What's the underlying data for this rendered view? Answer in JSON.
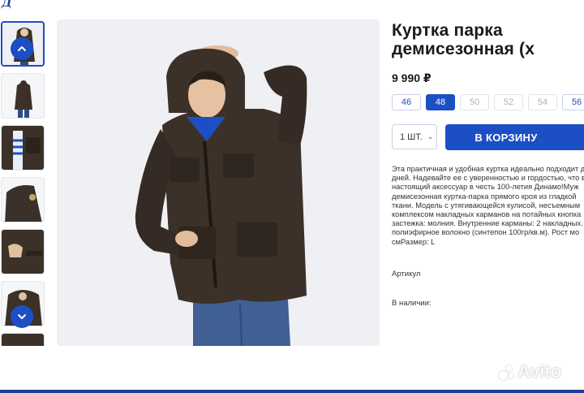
{
  "brand": {
    "logo_text": "Д"
  },
  "gallery": {
    "thumbnail_count": 7,
    "active_index": 0,
    "prev_icon": "chevron-up-icon",
    "next_icon": "chevron-down-icon"
  },
  "product": {
    "title_line1": "Куртка парка",
    "title_line2": "демисезонная (х",
    "price": "9 990 ₽",
    "sizes": [
      {
        "label": "46",
        "state": "available"
      },
      {
        "label": "48",
        "state": "selected"
      },
      {
        "label": "50",
        "state": "disabled"
      },
      {
        "label": "52",
        "state": "disabled"
      },
      {
        "label": "54",
        "state": "disabled"
      },
      {
        "label": "56",
        "state": "available"
      }
    ],
    "quantity": "1 ШТ.",
    "cart_button": "В КОРЗИНУ",
    "description_lines": [
      "Эта практичная и удобная куртка идеально подходит д",
      "дней. Надевайте ее с уверенностью и гордостью, что в",
      "настоящий аксессуар в честь 100-летия Динамо!Муж",
      "демисезонная куртка-парка прямого кроя из гладкой",
      "ткани. Модель с утягивающейся кулисой, несъемным",
      "комплексом накладных карманов на потайных кнопка",
      "застежка: молния. Внутренние карманы: 2 накладных.",
      "полиэфирное волокно (синтепон 100гр/кв.м). Рост мо",
      "смРазмер: L"
    ],
    "sku_label": "Артикул",
    "stock_label": "В наличии:"
  },
  "watermark": {
    "text": "Avito"
  },
  "colors": {
    "accent": "#1d4fc4",
    "brand_dark": "#1b3e99",
    "jacket": "#3b3129",
    "background": "#eef0f4"
  }
}
